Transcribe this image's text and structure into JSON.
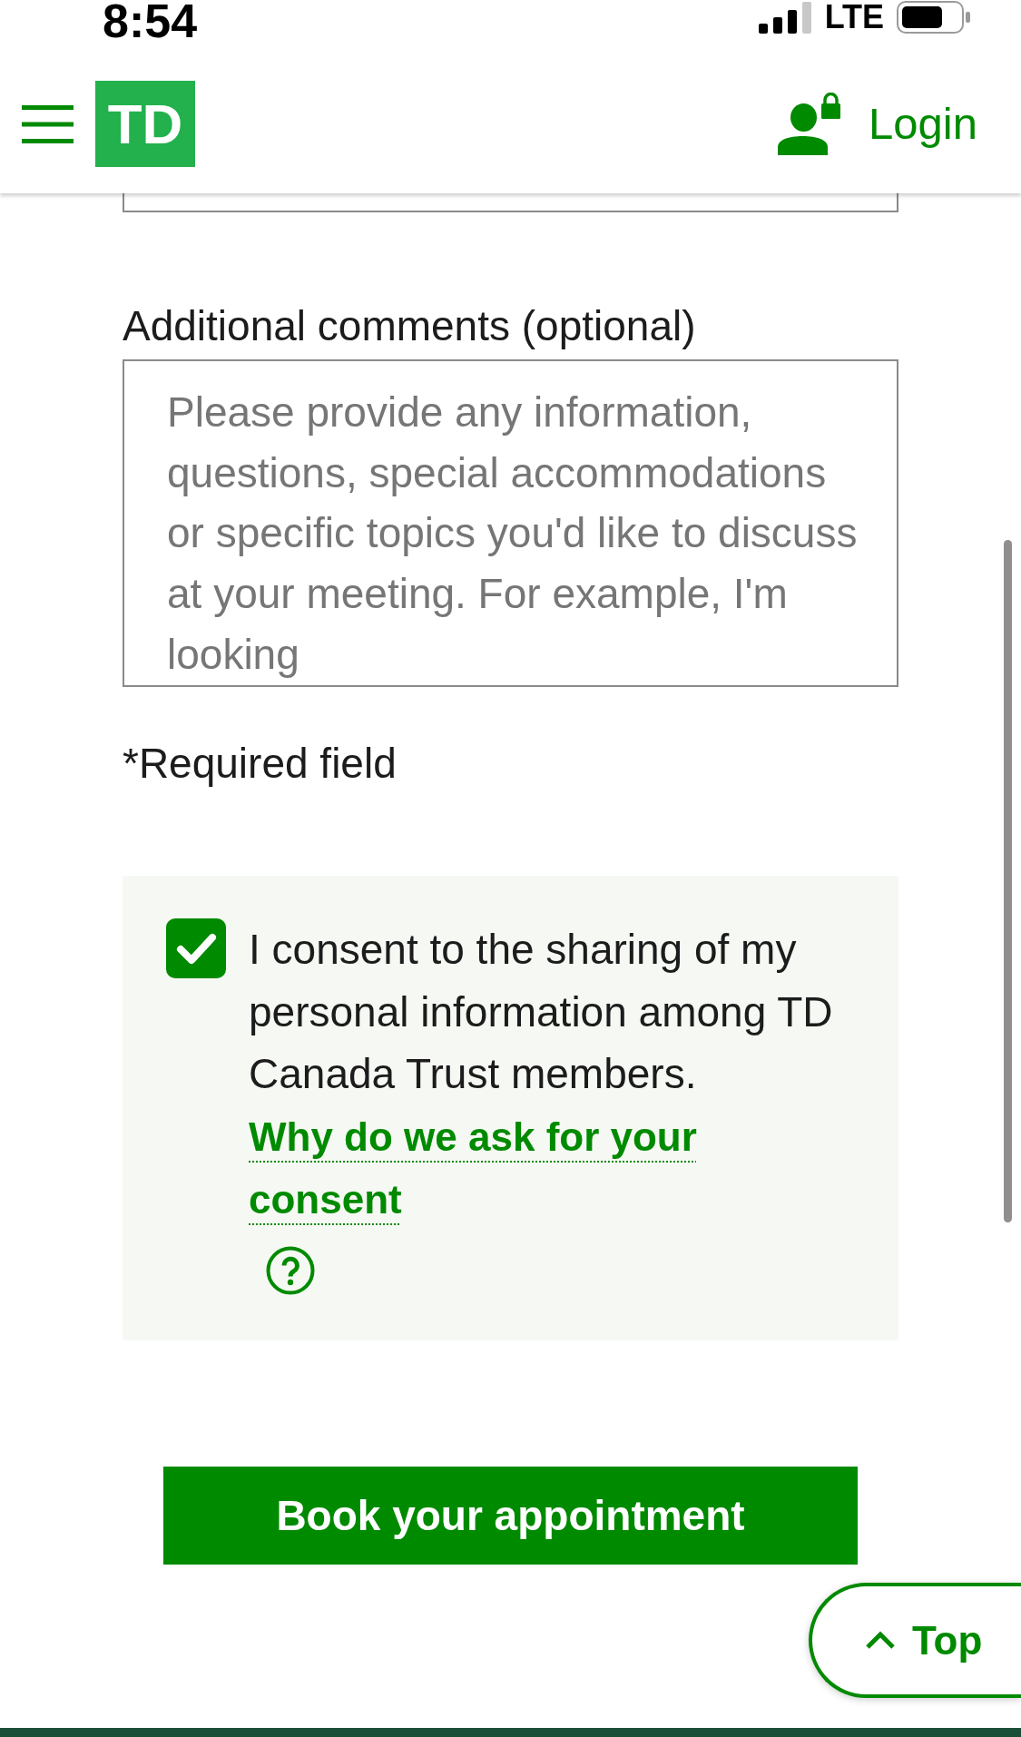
{
  "status_bar": {
    "time": "8:54",
    "network": "LTE"
  },
  "header": {
    "logo": "TD",
    "login": "Login"
  },
  "comments": {
    "label": "Additional comments (optional)",
    "placeholder": "Please provide any information, questions, special accommodations or specific topics you'd like to discuss at your meeting. For example, I'm looking"
  },
  "required_note": "*Required field",
  "consent": {
    "checked": true,
    "text": "I consent to the sharing of my personal information among TD Canada Trust members.",
    "link": "Why do we ask for your consent"
  },
  "submit_button": "Book your appointment",
  "top_button": "Top"
}
